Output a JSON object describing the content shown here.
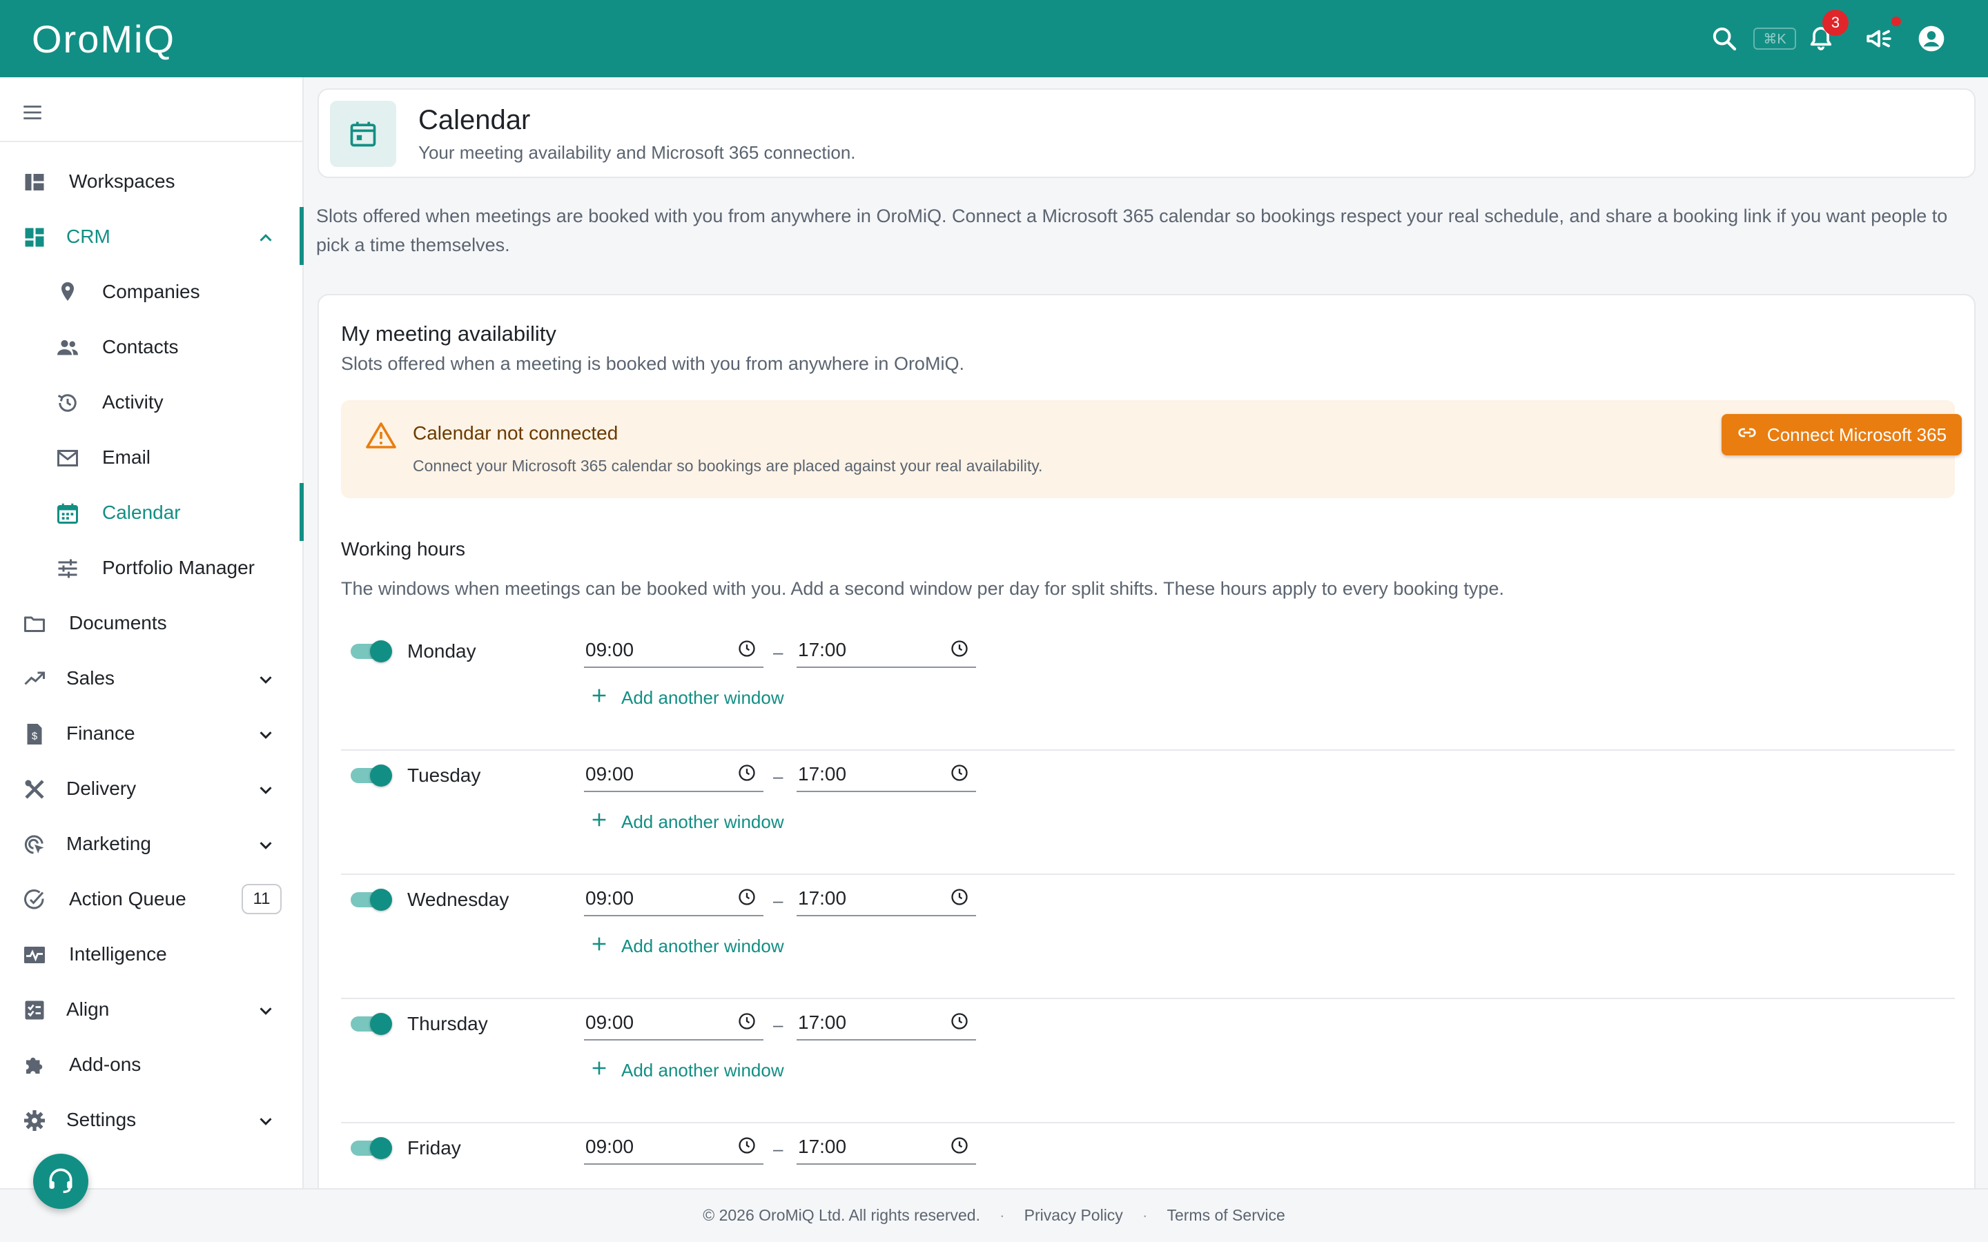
{
  "app": {
    "logo": "OroMiQ",
    "shortcut": "⌘K",
    "notification_count": "3"
  },
  "colors": {
    "brand": "#128f84",
    "warning": "#e97d10",
    "badge": "#e0262b"
  },
  "sidebar": {
    "items": [
      {
        "label": "Workspaces",
        "icon": "dashboard-icon"
      },
      {
        "label": "CRM",
        "icon": "grid-icon",
        "expanded": true
      },
      {
        "label": "Companies",
        "icon": "location-pin-icon"
      },
      {
        "label": "Contacts",
        "icon": "people-icon"
      },
      {
        "label": "Activity",
        "icon": "history-icon"
      },
      {
        "label": "Email",
        "icon": "mail-icon"
      },
      {
        "label": "Calendar",
        "icon": "calendar-icon",
        "active": true
      },
      {
        "label": "Portfolio Manager",
        "icon": "sliders-icon"
      },
      {
        "label": "Documents",
        "icon": "folder-icon"
      },
      {
        "label": "Sales",
        "icon": "trending-up-icon"
      },
      {
        "label": "Finance",
        "icon": "invoice-icon"
      },
      {
        "label": "Delivery",
        "icon": "tools-icon"
      },
      {
        "label": "Marketing",
        "icon": "target-click-icon"
      },
      {
        "label": "Action Queue",
        "icon": "check-circle-icon",
        "count": "11"
      },
      {
        "label": "Intelligence",
        "icon": "pulse-icon"
      },
      {
        "label": "Align",
        "icon": "checklist-icon"
      },
      {
        "label": "Add-ons",
        "icon": "puzzle-icon"
      },
      {
        "label": "Settings",
        "icon": "gear-icon"
      }
    ]
  },
  "header": {
    "title": "Calendar",
    "subtitle": "Your meeting availability and Microsoft 365 connection."
  },
  "intro": "Slots offered when meetings are booked with you from anywhere in OroMiQ. Connect a Microsoft 365 calendar so bookings respect your real schedule, and share a booking link if you want people to pick a time themselves.",
  "availability": {
    "title": "My meeting availability",
    "subtitle": "Slots offered when a meeting is booked with you from anywhere in OroMiQ.",
    "alert": {
      "title": "Calendar not connected",
      "text": "Connect your Microsoft 365 calendar so bookings are placed against your real availability.",
      "button": "Connect Microsoft 365"
    },
    "working_hours": {
      "title": "Working hours",
      "subtitle": "The windows when meetings can be booked with you. Add a second window per day for split shifts. These hours apply to every booking type.",
      "add_label": "Add another window",
      "separator": "–",
      "days": [
        {
          "name": "Monday",
          "enabled": true,
          "start": "09:00",
          "end": "17:00"
        },
        {
          "name": "Tuesday",
          "enabled": true,
          "start": "09:00",
          "end": "17:00"
        },
        {
          "name": "Wednesday",
          "enabled": true,
          "start": "09:00",
          "end": "17:00"
        },
        {
          "name": "Thursday",
          "enabled": true,
          "start": "09:00",
          "end": "17:00"
        },
        {
          "name": "Friday",
          "enabled": true,
          "start": "09:00",
          "end": "17:00"
        }
      ]
    }
  },
  "footer": {
    "copyright": "© 2026 OroMiQ Ltd. All rights reserved.",
    "dot": "·",
    "privacy": "Privacy Policy",
    "terms": "Terms of Service"
  }
}
